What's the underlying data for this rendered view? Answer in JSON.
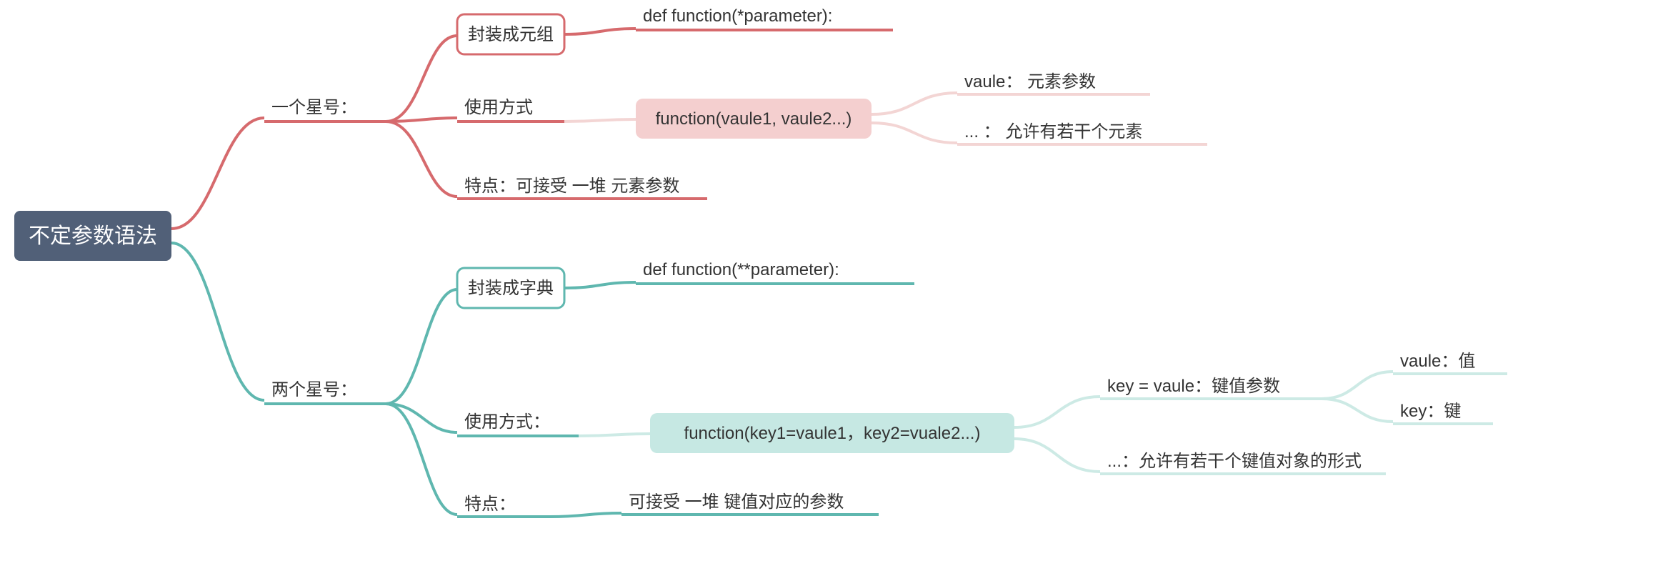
{
  "root": "不定参数语法",
  "branches": {
    "one_star": {
      "label": "一个星号：",
      "box_wrap": "封装成元组",
      "wrap_def": "def function(*parameter):",
      "usage_label": "使用方式",
      "usage_body": "function(vaule1, vaule2...)",
      "usage_sub1": "vaule： 元素参数",
      "usage_sub2": "... ：    允许有若干个元素",
      "feature": "特点：可接受 一堆 元素参数"
    },
    "two_star": {
      "label": "两个星号：",
      "box_wrap": "封装成字典",
      "wrap_def": "def function(**parameter):",
      "usage_label": "使用方式：",
      "usage_body": "function(key1=vaule1，key2=vuale2...)",
      "usage_sub1": "key = vaule：键值参数",
      "usage_sub2": "...：允许有若干个键值对象的形式",
      "usage_sub1a": "vaule：值",
      "usage_sub1b": "key：键",
      "feature_label": "特点：",
      "feature_body": "可接受 一堆 键值对应的参数"
    }
  },
  "colors": {
    "root_bg": "#516078",
    "red_stroke": "#d66a6d",
    "red_fill": "#f4cfcf",
    "red_light": "#f3d5d4",
    "teal_stroke": "#5fb7af",
    "teal_fill": "#c6e8e3",
    "teal_light": "#cdeae5"
  }
}
